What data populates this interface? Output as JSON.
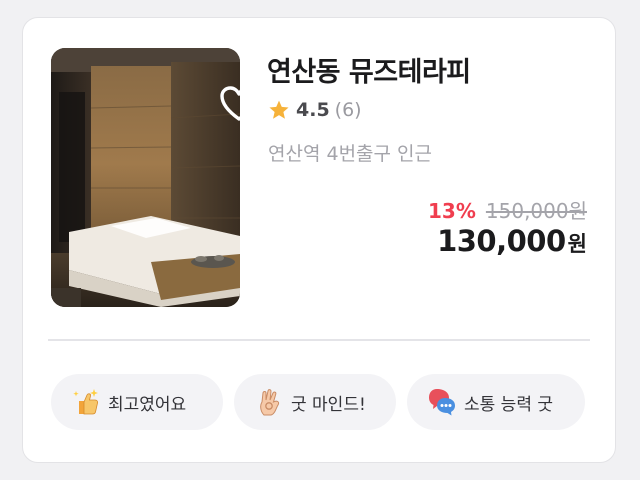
{
  "listing": {
    "title": "연산동 뮤즈테라피",
    "rating": {
      "score": "4.5",
      "count": "(6)",
      "stars_icon": "star-icon",
      "star_color": "#f6b23a"
    },
    "location": "연산역 4번출구 인근",
    "favorite_icon": "heart-outline-icon",
    "price": {
      "discount": "13%",
      "original": "150,000원",
      "final": "130,000",
      "currency": "원",
      "discount_color": "#f03e4f"
    }
  },
  "review_tags": [
    {
      "label": "최고였어요",
      "icon": "sparkle-thumbs-up-icon"
    },
    {
      "label": "굿 마인드!",
      "icon": "ok-hand-icon"
    },
    {
      "label": "소통 능력 굿",
      "icon": "chat-bubbles-icon"
    }
  ]
}
